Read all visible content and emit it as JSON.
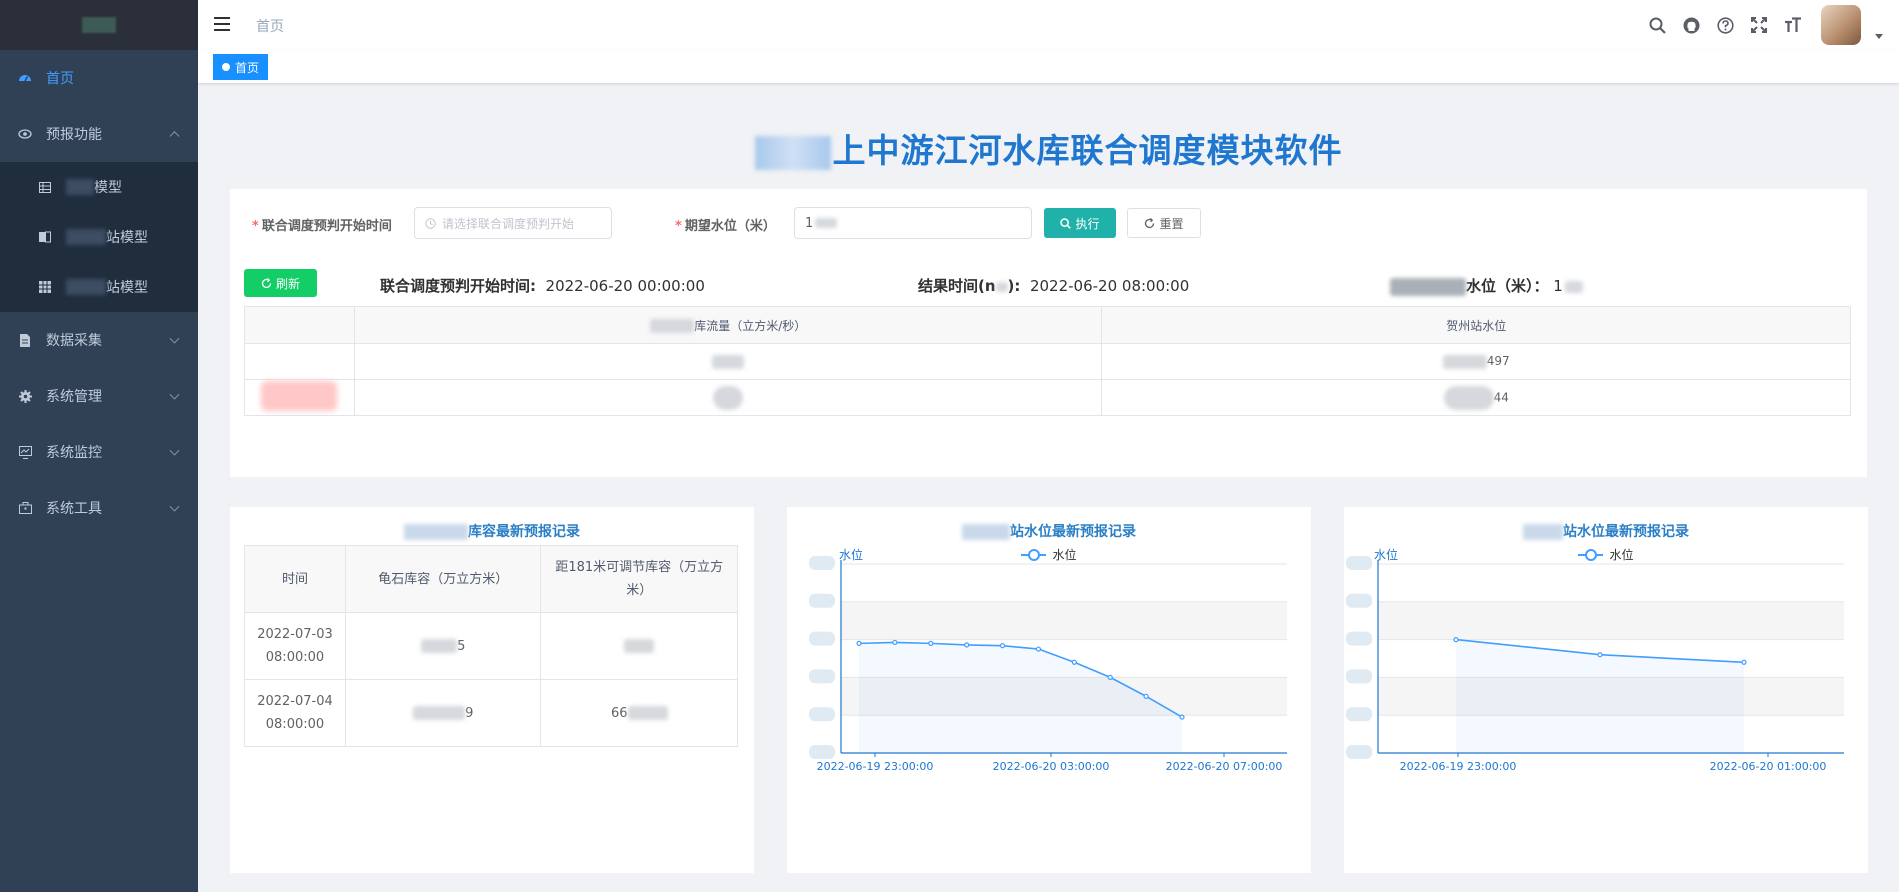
{
  "sidebar": {
    "items": [
      {
        "label": "首页",
        "icon": "dashboard-icon",
        "active": true
      },
      {
        "label": "预报功能",
        "icon": "eye-icon",
        "expanded": true,
        "children": [
          {
            "label": "模型",
            "icon": "table-icon"
          },
          {
            "label": "站模型",
            "icon": "book-icon"
          },
          {
            "label": "站模型",
            "icon": "grid-icon"
          }
        ]
      },
      {
        "label": "数据采集",
        "icon": "document-icon"
      },
      {
        "label": "系统管理",
        "icon": "gear-icon"
      },
      {
        "label": "系统监控",
        "icon": "monitor-icon"
      },
      {
        "label": "系统工具",
        "icon": "toolbox-icon"
      }
    ]
  },
  "header": {
    "breadcrumb": "首页",
    "icons": [
      "search-icon",
      "github-icon",
      "question-icon",
      "fullscreen-icon",
      "font-size-icon"
    ]
  },
  "tags": [
    {
      "label": "首页",
      "active": true
    }
  ],
  "page": {
    "title": "上中游江河水库联合调度模块软件"
  },
  "form": {
    "start_label": "联合调度预判开始时间",
    "start_placeholder": "请选择联合调度预判开始",
    "level_label": "期望水位（米）",
    "level_value": "1",
    "exec_label": "执行",
    "reset_label": "重置",
    "refresh_label": "刷新"
  },
  "info": {
    "start_label": "联合调度预判开始时间:",
    "start_value": "2022-06-20 00:00:00",
    "end_label": "结果时间(n",
    "end_label_tail": "):",
    "end_value": "2022-06-20 08:00:00",
    "level_label": "水位（米）：",
    "level_value": "1"
  },
  "flow_table": {
    "headers": [
      "",
      "库流量（立方米/秒）",
      "贺州站水位"
    ],
    "rows": [
      [
        "",
        "",
        "497"
      ],
      [
        "",
        "",
        "44"
      ]
    ]
  },
  "capacity_card": {
    "title": "库容最新预报记录",
    "headers": [
      "时间",
      "龟石库容（万立方米）",
      "距181米可调节库容（万立方米）"
    ],
    "rows": [
      [
        "2022-07-03 08:00:00",
        "5",
        ""
      ],
      [
        "2022-07-04 08:00:00",
        "9",
        "66"
      ]
    ]
  },
  "chart_data": [
    {
      "type": "line",
      "title": "站水位最新预报记录",
      "ylabel": "水位",
      "series": [
        {
          "name": "水位",
          "values": [
            0.58,
            0.585,
            0.58,
            0.572,
            0.568,
            0.55,
            0.48,
            0.4,
            0.3,
            0.19
          ]
        }
      ],
      "x_tick_labels": [
        "2022-06-19 23:00:00",
        "2022-06-20 03:00:00",
        "2022-06-20 07:00:00"
      ],
      "ylim": [
        0,
        1
      ],
      "grid": true
    },
    {
      "type": "line",
      "title": "站水位最新预报记录",
      "ylabel": "水位",
      "series": [
        {
          "name": "水位",
          "values": [
            0.6,
            0.52,
            0.48
          ]
        }
      ],
      "x_tick_labels": [
        "2022-06-19 23:00:00",
        "2022-06-20 01:00:00"
      ],
      "ylim": [
        0,
        1
      ],
      "grid": true
    }
  ],
  "colors": {
    "sidebar_bg": "#304156",
    "accent": "#409eff",
    "title": "#1f77d0",
    "exec": "#20b2aa",
    "refresh": "#13ce66"
  }
}
